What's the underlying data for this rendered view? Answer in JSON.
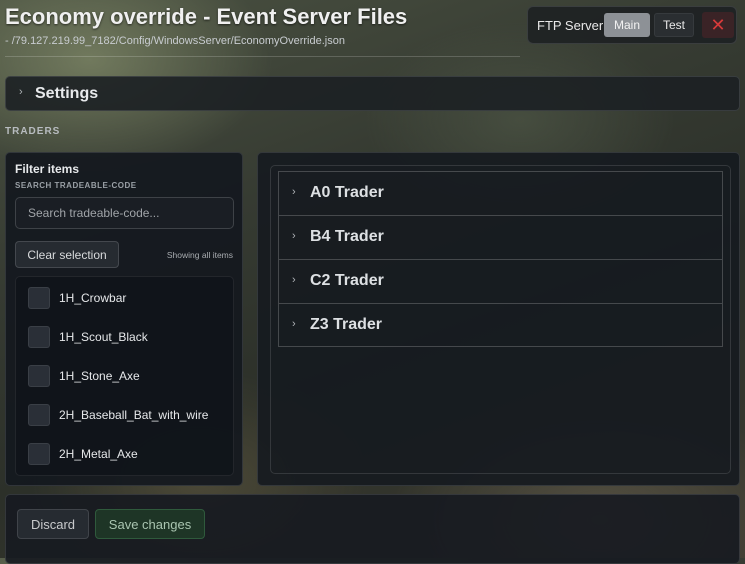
{
  "header": {
    "title": "Economy override - Event Server Files",
    "path": "- /79.127.219.99_7182/Config/WindowsServer/EconomyOverride.json"
  },
  "ftp": {
    "label": "FTP Server",
    "main_label": "Main",
    "test_label": "Test",
    "close_glyph": "✕",
    "selected": "Main",
    "close_color": "#d83a3a"
  },
  "settings": {
    "label": "Settings",
    "expanded": false
  },
  "traders_section": {
    "header": "TRADERS"
  },
  "filter": {
    "title": "Filter items",
    "search_label": "SEARCH TRADEABLE-CODE",
    "search_placeholder": "Search tradeable-code...",
    "search_value": "",
    "clear_label": "Clear selection",
    "showing_text": "Showing all items",
    "items": [
      {
        "label": "1H_Crowbar",
        "checked": false
      },
      {
        "label": "1H_Scout_Black",
        "checked": false
      },
      {
        "label": "1H_Stone_Axe",
        "checked": false
      },
      {
        "label": "2H_Baseball_Bat_with_wire",
        "checked": false
      },
      {
        "label": "2H_Metal_Axe",
        "checked": false
      }
    ]
  },
  "traders": [
    {
      "label": "A0 Trader",
      "expanded": false
    },
    {
      "label": "B4 Trader",
      "expanded": false
    },
    {
      "label": "C2 Trader",
      "expanded": false
    },
    {
      "label": "Z3 Trader",
      "expanded": false
    }
  ],
  "actions": {
    "discard_label": "Discard",
    "save_label": "Save changes",
    "save_color": "#1e3526"
  },
  "icons": {
    "chevron": "›",
    "chevron_name": "chevron-right-icon",
    "close_name": "close-icon"
  }
}
